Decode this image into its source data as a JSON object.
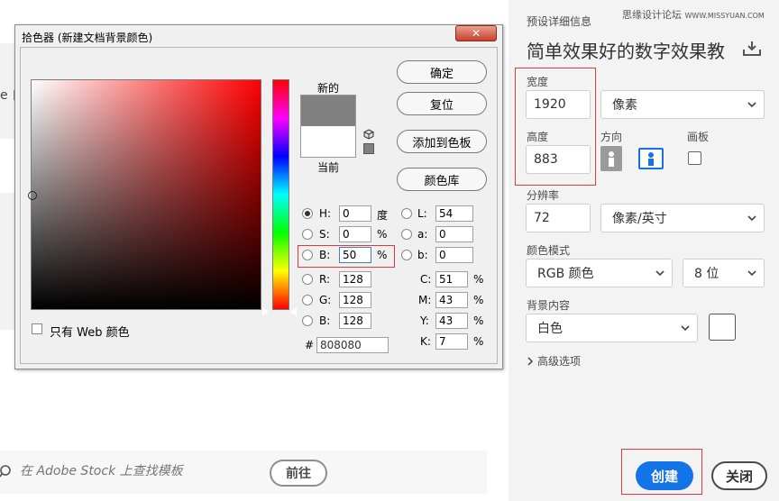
{
  "background": {
    "left_text": "e 自",
    "search_placeholder": "在 Adobe Stock 上查找模板",
    "goto_label": "前往"
  },
  "watermark": {
    "text": "思缘设计论坛",
    "url": "WWW.MISSYUAN.COM"
  },
  "right_panel": {
    "section_label": "预设详细信息",
    "doc_title": "简单效果好的数字效果教",
    "width_label": "宽度",
    "width_value": "1920",
    "width_unit": "像素",
    "height_label": "高度",
    "height_value": "883",
    "orientation_label": "方向",
    "artboard_label": "画板",
    "resolution_label": "分辨率",
    "resolution_value": "72",
    "resolution_unit": "像素/英寸",
    "color_mode_label": "颜色模式",
    "color_mode_value": "RGB 颜色",
    "bit_depth_value": "8 位",
    "bg_label": "背景内容",
    "bg_value": "白色",
    "advanced_label": "高级选项",
    "create_label": "创建",
    "close_label": "关闭"
  },
  "dialog": {
    "title": "拾色器 (新建文档背景颜色)",
    "new_label": "新的",
    "current_label": "当前",
    "ok_label": "确定",
    "reset_label": "复位",
    "add_swatch_label": "添加到色板",
    "library_label": "颜色库",
    "web_only_label": "只有 Web 颜色",
    "hsb": [
      {
        "label": "H:",
        "value": "0",
        "unit": "度"
      },
      {
        "label": "S:",
        "value": "0",
        "unit": "%"
      },
      {
        "label": "B:",
        "value": "50",
        "unit": "%"
      }
    ],
    "rgb": [
      {
        "label": "R:",
        "value": "128"
      },
      {
        "label": "G:",
        "value": "128"
      },
      {
        "label": "B:",
        "value": "128"
      }
    ],
    "lab": [
      {
        "label": "L:",
        "value": "54"
      },
      {
        "label": "a:",
        "value": "0"
      },
      {
        "label": "b:",
        "value": "0"
      }
    ],
    "cmyk": [
      {
        "label": "C:",
        "value": "51",
        "unit": "%"
      },
      {
        "label": "M:",
        "value": "43",
        "unit": "%"
      },
      {
        "label": "Y:",
        "value": "43",
        "unit": "%"
      },
      {
        "label": "K:",
        "value": "7",
        "unit": "%"
      }
    ],
    "hex_label": "#",
    "hex_value": "808080",
    "new_color": "#808080",
    "current_color": "#ffffff"
  },
  "colors": {
    "accent": "#1473e6",
    "highlight": "#e03a3a"
  }
}
